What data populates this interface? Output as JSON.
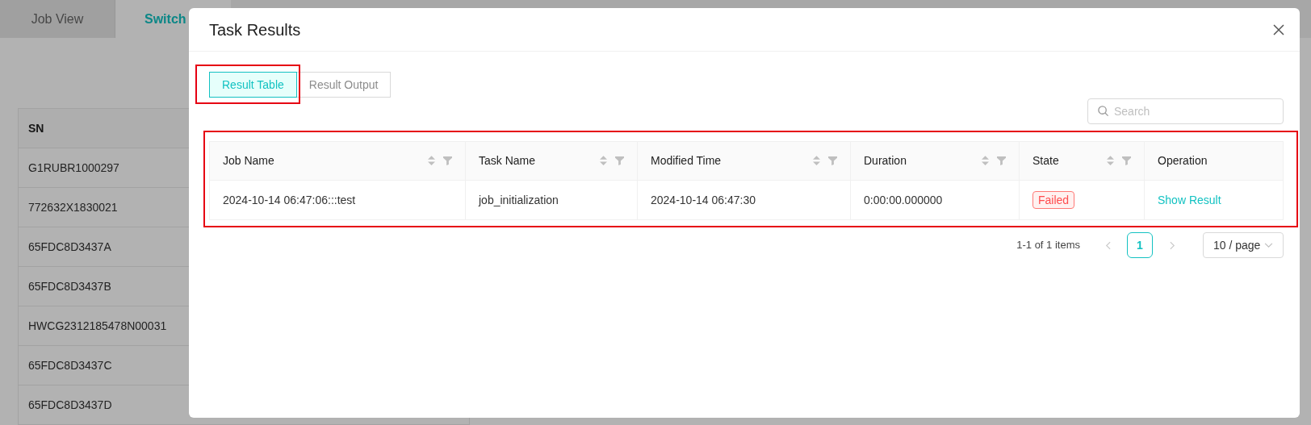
{
  "background": {
    "tabs": [
      {
        "label": "Job View",
        "selected": false
      },
      {
        "label": "Switch",
        "selected": true
      }
    ],
    "table": {
      "columns": [
        "SN"
      ],
      "rows": [
        "G1RUBR1000297",
        "772632X1830021",
        "65FDC8D3437A",
        "65FDC8D3437B",
        "HWCG2312185478N00031",
        "65FDC8D3437C",
        "65FDC8D3437D"
      ]
    }
  },
  "dialog": {
    "title": "Task Results",
    "view_tabs": [
      {
        "label": "Result Table",
        "selected": true
      },
      {
        "label": "Result Output",
        "selected": false
      }
    ],
    "search": {
      "placeholder": "Search"
    },
    "table": {
      "columns": [
        {
          "label": "Job Name",
          "sortable": true,
          "filterable": true
        },
        {
          "label": "Task Name",
          "sortable": true,
          "filterable": true
        },
        {
          "label": "Modified Time",
          "sortable": true,
          "filterable": true
        },
        {
          "label": "Duration",
          "sortable": true,
          "filterable": true
        },
        {
          "label": "State",
          "sortable": true,
          "filterable": true
        },
        {
          "label": "Operation",
          "sortable": false,
          "filterable": false
        }
      ],
      "rows": [
        {
          "cells": [
            {
              "kind": "text",
              "text": "2024-10-14 06:47:06:::test"
            },
            {
              "kind": "text",
              "text": "job_initialization"
            },
            {
              "kind": "text",
              "text": "2024-10-14 06:47:30"
            },
            {
              "kind": "text",
              "text": "0:00:00.000000"
            },
            {
              "kind": "tag",
              "text": "Failed"
            },
            {
              "kind": "link",
              "text": "Show Result"
            }
          ]
        }
      ]
    },
    "pagination": {
      "summary": "1-1 of 1 items",
      "prev": {
        "disabled": true
      },
      "pages": [
        {
          "label": "1",
          "selected": true
        }
      ],
      "next": {
        "disabled": true
      },
      "page_size": "10 / page"
    }
  }
}
